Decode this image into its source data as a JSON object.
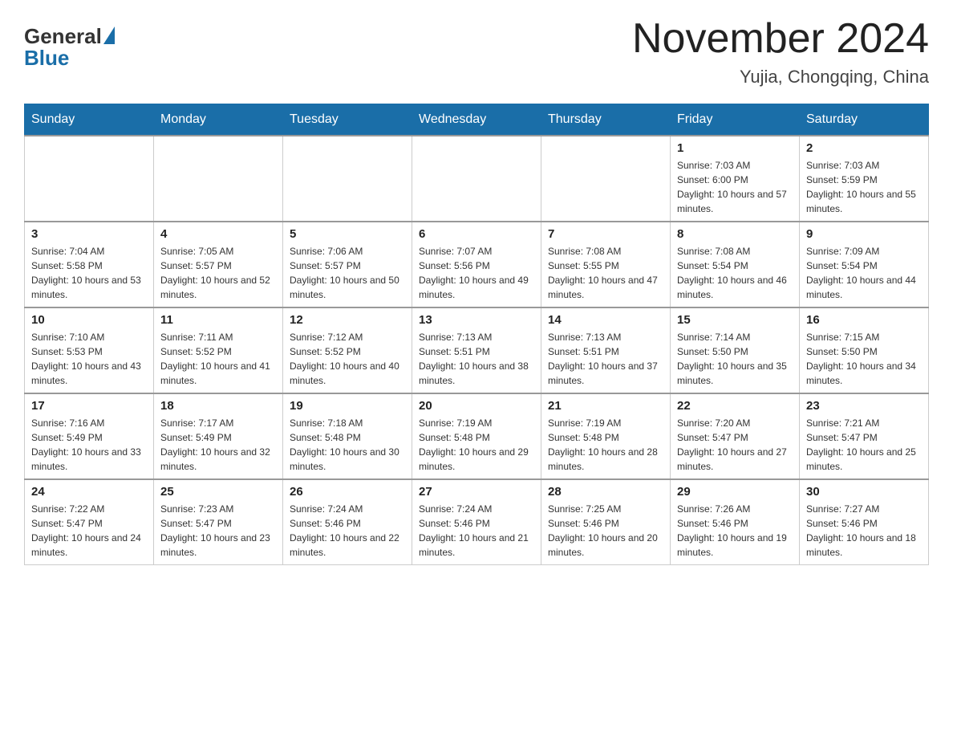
{
  "header": {
    "logo_general": "General",
    "logo_blue": "Blue",
    "title": "November 2024",
    "subtitle": "Yujia, Chongqing, China"
  },
  "days_of_week": [
    "Sunday",
    "Monday",
    "Tuesday",
    "Wednesday",
    "Thursday",
    "Friday",
    "Saturday"
  ],
  "weeks": [
    [
      {
        "day": "",
        "info": ""
      },
      {
        "day": "",
        "info": ""
      },
      {
        "day": "",
        "info": ""
      },
      {
        "day": "",
        "info": ""
      },
      {
        "day": "",
        "info": ""
      },
      {
        "day": "1",
        "info": "Sunrise: 7:03 AM\nSunset: 6:00 PM\nDaylight: 10 hours and 57 minutes."
      },
      {
        "day": "2",
        "info": "Sunrise: 7:03 AM\nSunset: 5:59 PM\nDaylight: 10 hours and 55 minutes."
      }
    ],
    [
      {
        "day": "3",
        "info": "Sunrise: 7:04 AM\nSunset: 5:58 PM\nDaylight: 10 hours and 53 minutes."
      },
      {
        "day": "4",
        "info": "Sunrise: 7:05 AM\nSunset: 5:57 PM\nDaylight: 10 hours and 52 minutes."
      },
      {
        "day": "5",
        "info": "Sunrise: 7:06 AM\nSunset: 5:57 PM\nDaylight: 10 hours and 50 minutes."
      },
      {
        "day": "6",
        "info": "Sunrise: 7:07 AM\nSunset: 5:56 PM\nDaylight: 10 hours and 49 minutes."
      },
      {
        "day": "7",
        "info": "Sunrise: 7:08 AM\nSunset: 5:55 PM\nDaylight: 10 hours and 47 minutes."
      },
      {
        "day": "8",
        "info": "Sunrise: 7:08 AM\nSunset: 5:54 PM\nDaylight: 10 hours and 46 minutes."
      },
      {
        "day": "9",
        "info": "Sunrise: 7:09 AM\nSunset: 5:54 PM\nDaylight: 10 hours and 44 minutes."
      }
    ],
    [
      {
        "day": "10",
        "info": "Sunrise: 7:10 AM\nSunset: 5:53 PM\nDaylight: 10 hours and 43 minutes."
      },
      {
        "day": "11",
        "info": "Sunrise: 7:11 AM\nSunset: 5:52 PM\nDaylight: 10 hours and 41 minutes."
      },
      {
        "day": "12",
        "info": "Sunrise: 7:12 AM\nSunset: 5:52 PM\nDaylight: 10 hours and 40 minutes."
      },
      {
        "day": "13",
        "info": "Sunrise: 7:13 AM\nSunset: 5:51 PM\nDaylight: 10 hours and 38 minutes."
      },
      {
        "day": "14",
        "info": "Sunrise: 7:13 AM\nSunset: 5:51 PM\nDaylight: 10 hours and 37 minutes."
      },
      {
        "day": "15",
        "info": "Sunrise: 7:14 AM\nSunset: 5:50 PM\nDaylight: 10 hours and 35 minutes."
      },
      {
        "day": "16",
        "info": "Sunrise: 7:15 AM\nSunset: 5:50 PM\nDaylight: 10 hours and 34 minutes."
      }
    ],
    [
      {
        "day": "17",
        "info": "Sunrise: 7:16 AM\nSunset: 5:49 PM\nDaylight: 10 hours and 33 minutes."
      },
      {
        "day": "18",
        "info": "Sunrise: 7:17 AM\nSunset: 5:49 PM\nDaylight: 10 hours and 32 minutes."
      },
      {
        "day": "19",
        "info": "Sunrise: 7:18 AM\nSunset: 5:48 PM\nDaylight: 10 hours and 30 minutes."
      },
      {
        "day": "20",
        "info": "Sunrise: 7:19 AM\nSunset: 5:48 PM\nDaylight: 10 hours and 29 minutes."
      },
      {
        "day": "21",
        "info": "Sunrise: 7:19 AM\nSunset: 5:48 PM\nDaylight: 10 hours and 28 minutes."
      },
      {
        "day": "22",
        "info": "Sunrise: 7:20 AM\nSunset: 5:47 PM\nDaylight: 10 hours and 27 minutes."
      },
      {
        "day": "23",
        "info": "Sunrise: 7:21 AM\nSunset: 5:47 PM\nDaylight: 10 hours and 25 minutes."
      }
    ],
    [
      {
        "day": "24",
        "info": "Sunrise: 7:22 AM\nSunset: 5:47 PM\nDaylight: 10 hours and 24 minutes."
      },
      {
        "day": "25",
        "info": "Sunrise: 7:23 AM\nSunset: 5:47 PM\nDaylight: 10 hours and 23 minutes."
      },
      {
        "day": "26",
        "info": "Sunrise: 7:24 AM\nSunset: 5:46 PM\nDaylight: 10 hours and 22 minutes."
      },
      {
        "day": "27",
        "info": "Sunrise: 7:24 AM\nSunset: 5:46 PM\nDaylight: 10 hours and 21 minutes."
      },
      {
        "day": "28",
        "info": "Sunrise: 7:25 AM\nSunset: 5:46 PM\nDaylight: 10 hours and 20 minutes."
      },
      {
        "day": "29",
        "info": "Sunrise: 7:26 AM\nSunset: 5:46 PM\nDaylight: 10 hours and 19 minutes."
      },
      {
        "day": "30",
        "info": "Sunrise: 7:27 AM\nSunset: 5:46 PM\nDaylight: 10 hours and 18 minutes."
      }
    ]
  ]
}
